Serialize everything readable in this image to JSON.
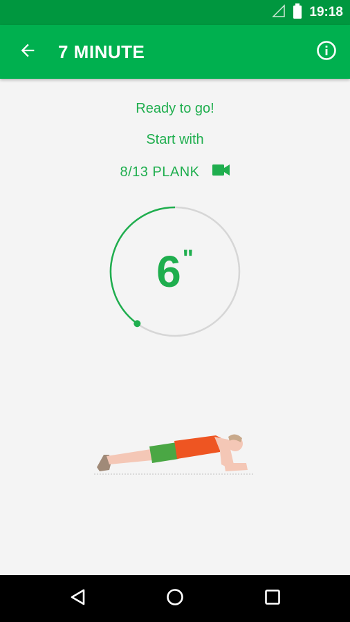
{
  "status_bar": {
    "time": "19:18",
    "icons": [
      "signal-icon",
      "battery-icon"
    ]
  },
  "app_bar": {
    "title": "7 MINUTE",
    "back_icon": "arrow-back-icon",
    "info_icon": "info-icon"
  },
  "main": {
    "ready_text": "Ready to go!",
    "start_text": "Start with",
    "exercise_label": "8/13 PLANK",
    "video_icon": "videocam-icon",
    "timer": {
      "value": "6",
      "unit": "\"",
      "progress": 0.4
    }
  },
  "colors": {
    "primary": "#00b04f",
    "primary_dark": "#00973f",
    "accent_green": "#1fae4e",
    "track_gray": "#d6d6d6"
  },
  "nav_bar": {
    "icons": [
      "back-triangle-icon",
      "home-circle-icon",
      "recents-square-icon"
    ]
  }
}
